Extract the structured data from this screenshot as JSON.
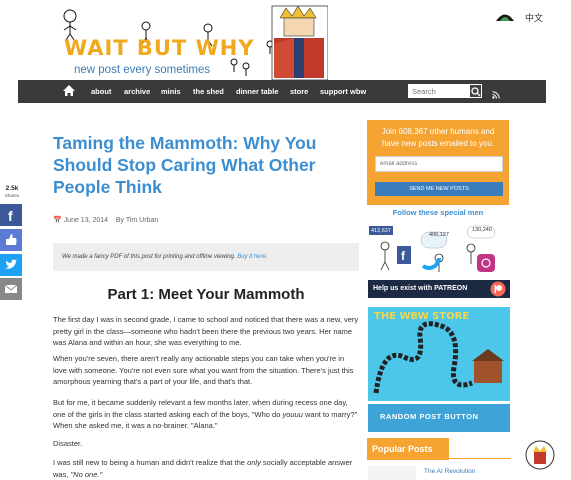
{
  "header": {
    "logo_title": "WAIT BUT WHY",
    "logo_subtitle": "new post every sometimes",
    "language_label": "中文"
  },
  "nav": {
    "items": [
      "about",
      "archive",
      "minis",
      "the shed",
      "dinner table",
      "store",
      "support wbw"
    ],
    "search_placeholder": "Search"
  },
  "article": {
    "title": "Taming the Mammoth: Why You Should Stop Caring What Other People Think",
    "date": "June 13, 2014",
    "author": "By Tim Urban",
    "pdf_text": "We made a fancy PDF of this post for printing and offline viewing.",
    "pdf_link": "Buy it here.",
    "part_title": "Part 1: Meet Your Mammoth",
    "paragraphs": [
      "The first day I was in second grade, I came to school and noticed that there was a new, very pretty girl in the class—someone who hadn't been there the previous two years. Her name was Alana and within an hour, she was everything to me.",
      "When you're seven, there aren't really any actionable steps you can take when you're in love with someone. You're not even sure what you want from the situation. There's just this amorphous yearning that's a part of your life, and that's that.",
      "But for me, it became suddenly relevant a few months later, when during recess one day, one of the girls in the class started asking each of the boys, \"Who do ",
      "Disaster.",
      "I was still new to being a human and didn't realize that the "
    ],
    "p3_italic": "youuu",
    "p3_end": " want to marry?\" When she asked me, it was a no-brainer. \"Alana.\"",
    "p5_italic": "only",
    "p5_end": " socially acceptable answer was, ",
    "p5_quote": "\"No one.\""
  },
  "share": {
    "count": "2.5k",
    "label": "Shares"
  },
  "sidebar": {
    "subscribe_text": "Join 608,367 other humans and have new posts emailed to you.",
    "email_placeholder": "email address",
    "send_button": "SEND ME NEW POSTS",
    "follow_heading": "Follow these special men",
    "social_counts": [
      "412,637",
      "406,127",
      "130,240"
    ],
    "patreon_text": "Help us exist with PATREON",
    "store_title": "THE WBW STORE",
    "random_post": "RANDOM POST BUTTON",
    "popular_heading": "Popular Posts",
    "popular_item": "The AI Revolution"
  },
  "colors": {
    "accent_blue": "#3c8ed0",
    "accent_orange": "#f5a431",
    "nav_bg": "#3a3a3a",
    "facebook": "#3b5998",
    "twitter": "#1da1f2"
  }
}
